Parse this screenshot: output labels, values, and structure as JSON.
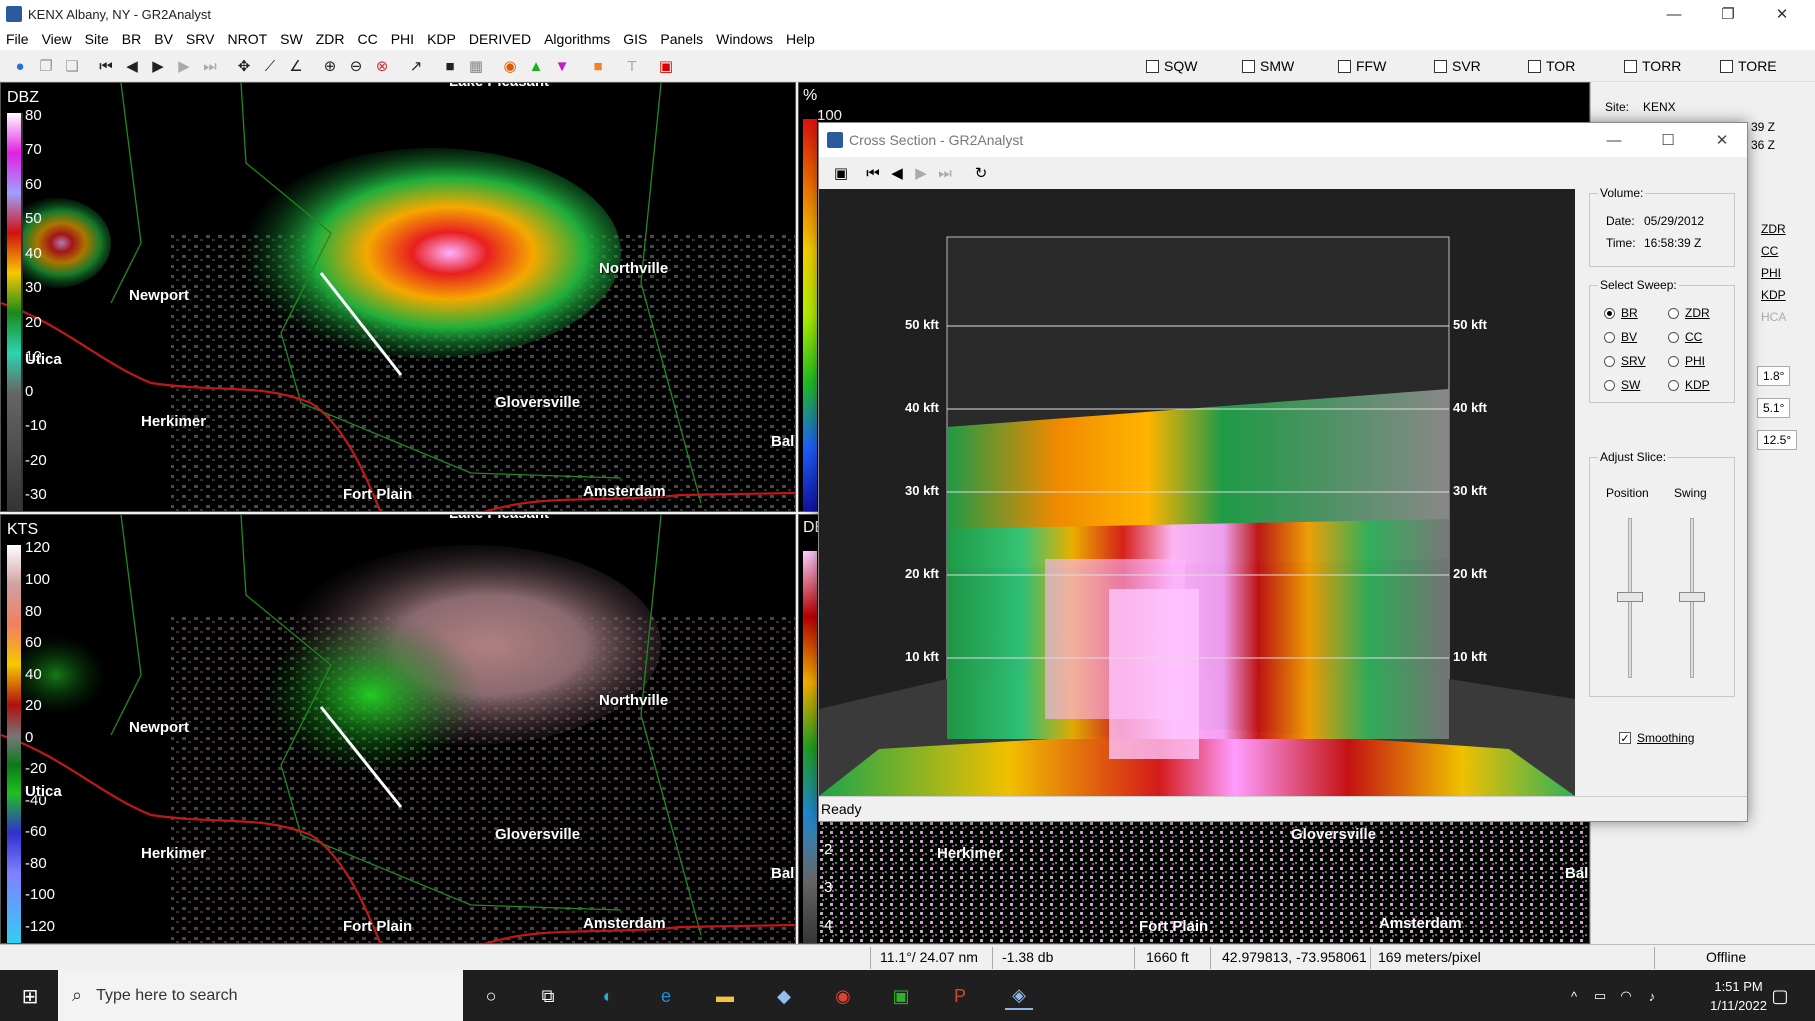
{
  "window": {
    "title": "KENX Albany, NY - GR2Analyst",
    "minimize": "—",
    "maximize": "❐",
    "close": "✕"
  },
  "menu": [
    "File",
    "View",
    "Site",
    "BR",
    "BV",
    "SRV",
    "NROT",
    "SW",
    "ZDR",
    "CC",
    "PHI",
    "KDP",
    "DERIVED",
    "Algorithms",
    "GIS",
    "Panels",
    "Windows",
    "Help"
  ],
  "toolbar": {
    "icons": [
      "globe-icon",
      "copy-icon",
      "paste-icon",
      "skip-back-icon",
      "step-back-icon",
      "play-icon",
      "step-forward-icon",
      "skip-forward-icon",
      "pan-icon",
      "measure-icon",
      "angle-icon",
      "zoom-in-icon",
      "zoom-out-icon",
      "zoom-reset-icon",
      "cross-section-icon",
      "black-square-icon",
      "grid-icon",
      "color-icon",
      "triangle-up-icon",
      "triangle-down-icon",
      "orange-square-icon",
      "text-icon",
      "record-icon"
    ],
    "warnings": [
      "SQW",
      "SMW",
      "FFW",
      "SVR",
      "TOR",
      "TORR",
      "TORE"
    ]
  },
  "pane_reflectivity": {
    "unit": "DBZ",
    "legend": [
      "80",
      "70",
      "60",
      "50",
      "40",
      "30",
      "20",
      "10",
      "0",
      "-10",
      "-20",
      "-30"
    ],
    "cities": [
      "Newport",
      "Northville",
      "Utica",
      "Herkimer",
      "Gloversville",
      "Fort Plain",
      "Amsterdam",
      "Bal",
      "Lake Pleasant"
    ]
  },
  "pane_velocity": {
    "unit": "KTS",
    "legend": [
      "120",
      "100",
      "80",
      "60",
      "40",
      "20",
      "0",
      "-20",
      "-40",
      "-60",
      "-80",
      "-100",
      "-120"
    ],
    "cities": [
      "Newport",
      "Northville",
      "Utica",
      "Herkimer",
      "Gloversville",
      "Fort Plain",
      "Amsterdam",
      "Bal",
      "Lake Pleasant"
    ]
  },
  "pane_cc": {
    "unit": "%",
    "legend_top": "100"
  },
  "pane_zdr": {
    "unit": "DE",
    "legend": [
      "-2",
      "-3",
      "-4"
    ],
    "cities": [
      "Herkimer",
      "Gloversville",
      "Fort Plain",
      "Amsterdam",
      "Bal"
    ]
  },
  "side_panel": {
    "site_label": "Site:",
    "site": "KENX",
    "time1": "39 Z",
    "time2": "36 Z",
    "products": [
      "ZDR",
      "CC",
      "PHI",
      "KDP",
      "HCA"
    ],
    "tilts": [
      "1.8°",
      "5.1°",
      "12.5°"
    ]
  },
  "cross_section": {
    "title": "Cross Section - GR2Analyst",
    "status": "Ready",
    "height_labels": [
      "50 kft",
      "40 kft",
      "30 kft",
      "20 kft",
      "10 kft"
    ],
    "volume": {
      "label": "Volume:",
      "date_label": "Date:",
      "date": "05/29/2012",
      "time_label": "Time:",
      "time": "16:58:39 Z"
    },
    "sweep": {
      "label": "Select Sweep:",
      "options": [
        "BR",
        "ZDR",
        "BV",
        "CC",
        "SRV",
        "PHI",
        "SW",
        "KDP"
      ],
      "selected": "BR"
    },
    "slice": {
      "label": "Adjust Slice:",
      "position": "Position",
      "swing": "Swing"
    },
    "smoothing": {
      "label": "Smoothing",
      "checked": true
    }
  },
  "statusbar": {
    "azimuth": "11.1°/ 24.07 nm",
    "value": "-1.38 db",
    "height": "1660 ft",
    "coords": "42.979813, -73.958061",
    "resolution": "169 meters/pixel",
    "mode": "Offline"
  },
  "taskbar": {
    "search_placeholder": "Type here to search",
    "time": "1:51 PM",
    "date": "1/11/2022"
  }
}
